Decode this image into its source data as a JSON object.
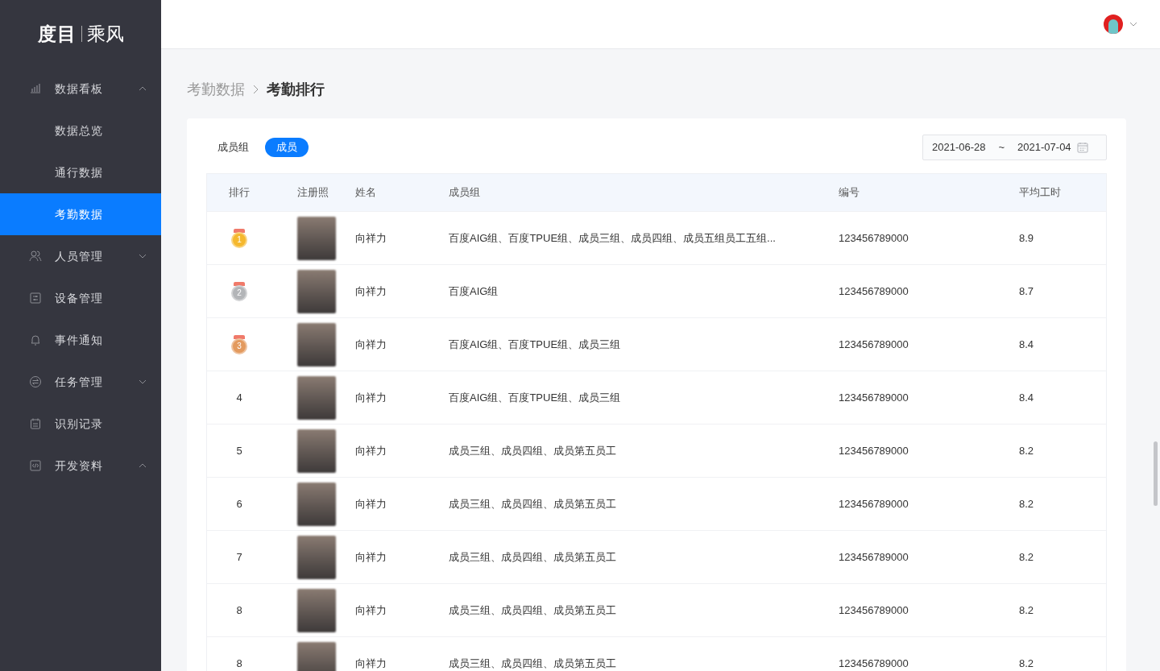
{
  "logo": {
    "brand": "度目",
    "product": "乘风"
  },
  "sidebar": {
    "items": [
      {
        "label": "数据看板",
        "expanded": true,
        "selected": false,
        "children": [
          {
            "label": "数据总览",
            "selected": false
          },
          {
            "label": "通行数据",
            "selected": false
          },
          {
            "label": "考勤数据",
            "selected": true
          }
        ]
      },
      {
        "label": "人员管理",
        "expanded": false,
        "selected": false
      },
      {
        "label": "设备管理",
        "selected": false
      },
      {
        "label": "事件通知",
        "selected": false
      },
      {
        "label": "任务管理",
        "expanded": false,
        "selected": false
      },
      {
        "label": "识别记录",
        "selected": false
      },
      {
        "label": "开发资料",
        "expanded": true,
        "selected": false
      }
    ]
  },
  "breadcrumb": [
    "考勤数据",
    "考勤排行"
  ],
  "tabs": [
    {
      "label": "成员组",
      "selected": false
    },
    {
      "label": "成员",
      "selected": true
    }
  ],
  "date_range": {
    "start": "2021-06-28",
    "separator": "~",
    "end": "2021-07-04"
  },
  "table": {
    "columns": [
      "排行",
      "注册照",
      "姓名",
      "成员组",
      "编号",
      "平均工时"
    ],
    "rows": [
      {
        "rank": "1",
        "kind": "medal",
        "color": "#f5b82e",
        "name": "向祥力",
        "group": "百度AIG组、百度TPUE组、成员三组、成员四组、成员五组员工五组...",
        "id": "123456789000",
        "hours": "8.9"
      },
      {
        "rank": "2",
        "kind": "medal",
        "color": "#b3b5b8",
        "name": "向祥力",
        "group": "百度AIG组",
        "id": "123456789000",
        "hours": "8.7"
      },
      {
        "rank": "3",
        "kind": "medal",
        "color": "#e39a5e",
        "name": "向祥力",
        "group": "百度AIG组、百度TPUE组、成员三组",
        "id": "123456789000",
        "hours": "8.4"
      },
      {
        "rank": "4",
        "kind": "plain",
        "name": "向祥力",
        "group": "百度AIG组、百度TPUE组、成员三组",
        "id": "123456789000",
        "hours": "8.4"
      },
      {
        "rank": "5",
        "kind": "plain",
        "name": "向祥力",
        "group": "成员三组、成员四组、成员第五员工",
        "id": "123456789000",
        "hours": "8.2"
      },
      {
        "rank": "6",
        "kind": "plain",
        "name": "向祥力",
        "group": "成员三组、成员四组、成员第五员工",
        "id": "123456789000",
        "hours": "8.2"
      },
      {
        "rank": "7",
        "kind": "plain",
        "name": "向祥力",
        "group": "成员三组、成员四组、成员第五员工",
        "id": "123456789000",
        "hours": "8.2"
      },
      {
        "rank": "8",
        "kind": "plain",
        "name": "向祥力",
        "group": "成员三组、成员四组、成员第五员工",
        "id": "123456789000",
        "hours": "8.2"
      },
      {
        "rank": "8",
        "kind": "plain",
        "name": "向祥力",
        "group": "成员三组、成员四组、成员第五员工",
        "id": "123456789000",
        "hours": "8.2"
      }
    ]
  }
}
